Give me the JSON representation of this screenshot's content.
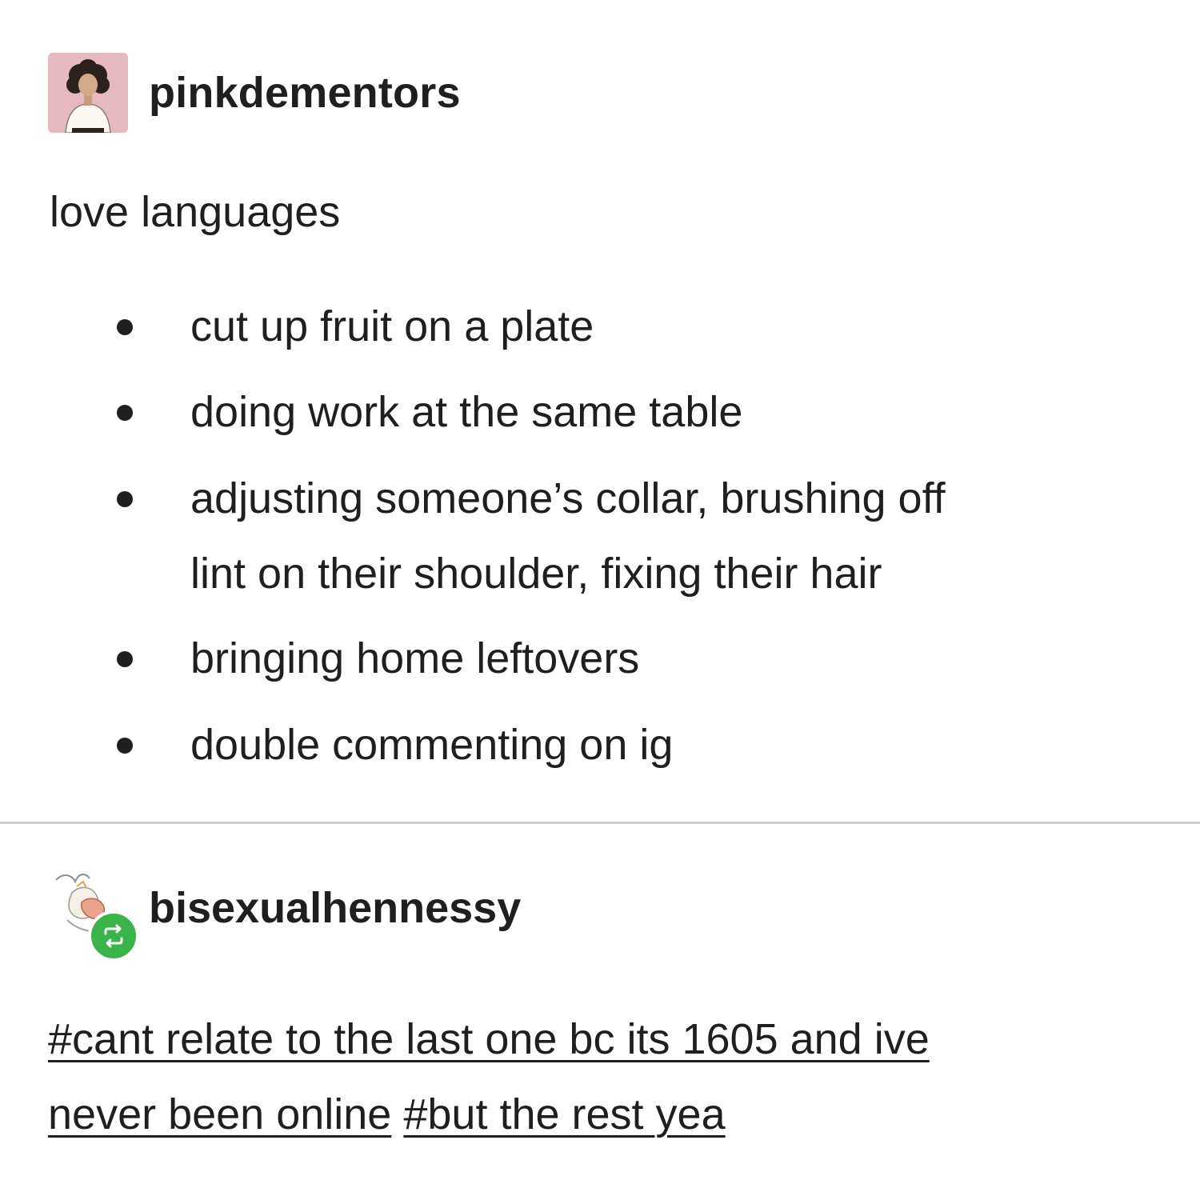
{
  "original_post": {
    "username": "pinkdementors",
    "avatar_icon": "portrait-avatar-icon",
    "title": "love languages",
    "items": [
      "cut up fruit on a plate",
      "doing work at the same table",
      "adjusting someone’s collar, brushing off",
      "lint on their shoulder, fixing their hair",
      "bringing home leftovers",
      "double commenting on ig"
    ]
  },
  "reblog": {
    "username": "bisexualhennessy",
    "avatar_icon": "illustrated-avatar-icon",
    "badge_icon": "reblog-icon",
    "badge_color": "#3ab44a",
    "tags": [
      "#cant relate to the last one bc its 1605 and ive",
      "never been online",
      "#but the rest yea"
    ]
  },
  "colors": {
    "text": "#1f1f1f",
    "background": "#ffffff",
    "divider": "#cfcfcf",
    "avatar_background": "#e5b9bf"
  }
}
